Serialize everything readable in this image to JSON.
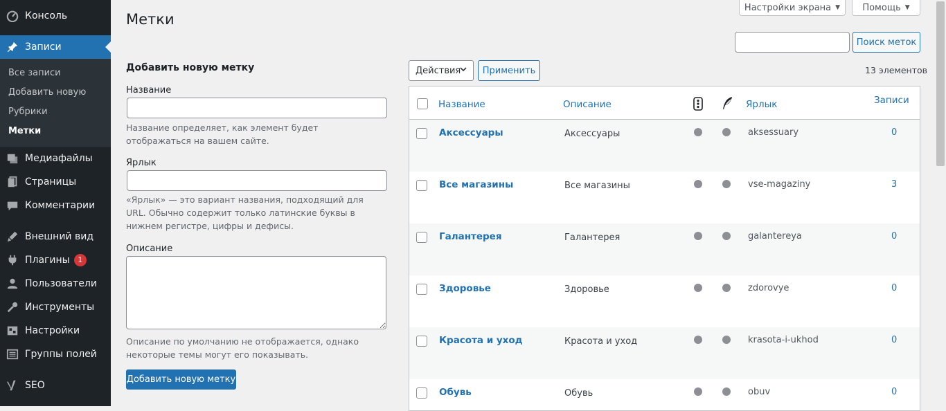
{
  "sidebar": {
    "items": [
      {
        "label": "Консоль",
        "icon": "dashboard-icon"
      },
      {
        "label": "Записи",
        "icon": "pin-icon",
        "active": true
      },
      {
        "label": "Медиафайлы",
        "icon": "media-icon"
      },
      {
        "label": "Страницы",
        "icon": "pages-icon"
      },
      {
        "label": "Комментарии",
        "icon": "comments-icon"
      },
      {
        "label": "Внешний вид",
        "icon": "appearance-icon"
      },
      {
        "label": "Плагины",
        "icon": "plugins-icon",
        "badge": "1"
      },
      {
        "label": "Пользователи",
        "icon": "users-icon"
      },
      {
        "label": "Инструменты",
        "icon": "tools-icon"
      },
      {
        "label": "Настройки",
        "icon": "settings-icon"
      },
      {
        "label": "Группы полей",
        "icon": "fields-icon"
      },
      {
        "label": "SEO",
        "icon": "yoast-icon"
      }
    ],
    "submenu": [
      "Все записи",
      "Добавить новую",
      "Рубрики",
      "Метки"
    ]
  },
  "header": {
    "screen_options": "Настройки экрана",
    "help": "Помощь",
    "title": "Метки",
    "search_value": "",
    "search_button": "Поиск меток"
  },
  "form": {
    "heading": "Добавить новую метку",
    "name_label": "Название",
    "name_value": "",
    "name_hint": "Название определяет, как элемент будет отображаться на вашем сайте.",
    "slug_label": "Ярлык",
    "slug_value": "",
    "slug_hint": "«Ярлык» — это вариант названия, подходящий для URL. Обычно содержит только латинские буквы в нижнем регистре, цифры и дефисы.",
    "desc_label": "Описание",
    "desc_value": "",
    "desc_hint": "Описание по умолчанию не отображается, однако некоторые темы могут его показывать.",
    "submit": "Добавить новую метку"
  },
  "table": {
    "bulk_action": "Действия",
    "apply": "Применить",
    "count": "13 элементов",
    "columns": {
      "name": "Название",
      "description": "Описание",
      "slug": "Ярлык",
      "posts": "Записи"
    },
    "rows": [
      {
        "name": "Аксессуары",
        "description": "Аксессуары",
        "slug": "aksessuary",
        "posts": "0"
      },
      {
        "name": "Все магазины",
        "description": "Все магазины",
        "slug": "vse-magaziny",
        "posts": "3"
      },
      {
        "name": "Галантерея",
        "description": "Галантерея",
        "slug": "galantereya",
        "posts": "0"
      },
      {
        "name": "Здоровье",
        "description": "Здоровье",
        "slug": "zdorovye",
        "posts": "0"
      },
      {
        "name": "Красота и уход",
        "description": "Красота и уход",
        "slug": "krasota-i-ukhod",
        "posts": "0"
      },
      {
        "name": "Обувь",
        "description": "Обувь",
        "slug": "obuv",
        "posts": "0"
      }
    ]
  },
  "colors": {
    "accent": "#2271b1",
    "sidebar": "#1d2327",
    "badge": "#d63638"
  }
}
